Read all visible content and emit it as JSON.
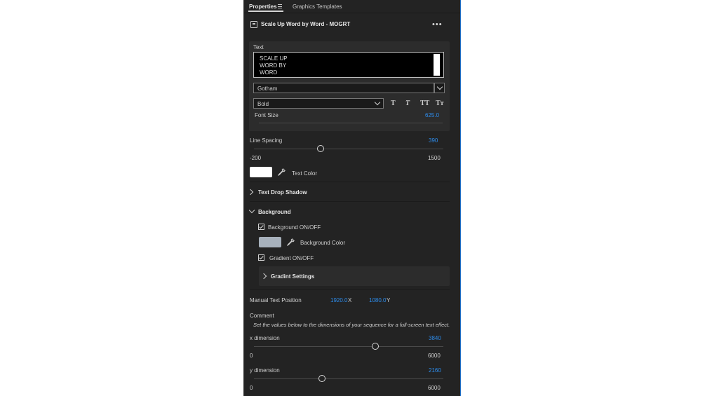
{
  "tabs": {
    "properties": "Properties",
    "graphics_templates": "Graphics Templates"
  },
  "template": {
    "title": "Scale Up Word by Word - MOGRT"
  },
  "text_section": {
    "label": "Text",
    "lines": [
      "SCALE UP",
      "WORD BY",
      "WORD"
    ],
    "font": "Gotham",
    "style": "Bold",
    "style_buttons": [
      "T",
      "T",
      "TT",
      "Tт"
    ],
    "font_size_label": "Font Size",
    "font_size_value": "625.0"
  },
  "line_spacing": {
    "label": "Line Spacing",
    "value": "390",
    "min": "-200",
    "max": "1500",
    "fraction": 0.35
  },
  "text_color": {
    "label": "Text Color",
    "color": "#ffffff"
  },
  "drop_shadow": {
    "label": "Text Drop Shadow"
  },
  "background": {
    "label": "Background",
    "onoff_label": "Background ON/OFF",
    "color_label": "Background Color",
    "color": "#a7b1bc",
    "gradient_label": "Gradient ON/OFF",
    "gradient_settings": "Gradint Settings"
  },
  "manual_position": {
    "label": "Manual Text Position",
    "x_value": "1920.0",
    "x_axis": "X",
    "y_value": "1080.0",
    "y_axis": "Y"
  },
  "comment": {
    "label": "Comment",
    "text": "Set the values below to the dimensions of your sequence for a full-screen text effect."
  },
  "x_dimension": {
    "label": "x dimension",
    "value": "3840",
    "min": "0",
    "max": "6000",
    "fraction": 0.64
  },
  "y_dimension": {
    "label": "y dimension",
    "value": "2160",
    "min": "0",
    "max": "6000",
    "fraction": 0.36
  },
  "colors": {
    "accent": "#2d8ceb",
    "panel": "#232323"
  }
}
